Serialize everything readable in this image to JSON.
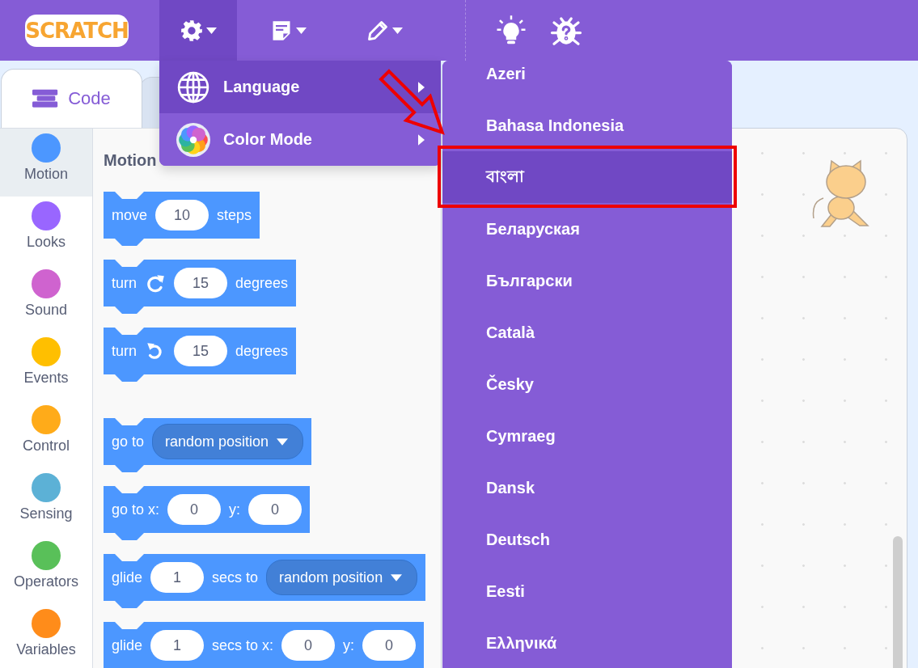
{
  "logo": "SCRATCH",
  "menu_bar": [
    {
      "kind": "settings",
      "selected": true
    },
    {
      "kind": "file",
      "selected": false
    },
    {
      "kind": "edit",
      "selected": false
    }
  ],
  "help_buttons": [
    {
      "kind": "tips"
    },
    {
      "kind": "debug"
    }
  ],
  "settings_menu": [
    {
      "kind": "language",
      "label": "Language",
      "selected": true
    },
    {
      "kind": "color",
      "label": "Color Mode",
      "selected": false
    }
  ],
  "language_menu": [
    {
      "label": "Azeri",
      "selected": false
    },
    {
      "label": "Bahasa Indonesia",
      "selected": false
    },
    {
      "label": "বাংলা",
      "selected": true
    },
    {
      "label": "Беларуская",
      "selected": false
    },
    {
      "label": "Български",
      "selected": false
    },
    {
      "label": "Català",
      "selected": false
    },
    {
      "label": "Česky",
      "selected": false
    },
    {
      "label": "Cymraeg",
      "selected": false
    },
    {
      "label": "Dansk",
      "selected": false
    },
    {
      "label": "Deutsch",
      "selected": false
    },
    {
      "label": "Eesti",
      "selected": false
    },
    {
      "label": "Ελληνικά",
      "selected": false
    }
  ],
  "tabs": [
    {
      "label": "Code",
      "selected": true
    },
    {
      "selected": false
    }
  ],
  "categories": [
    {
      "label": "Motion",
      "color": "#4c97ff",
      "selected": true
    },
    {
      "label": "Looks",
      "color": "#9966ff",
      "selected": false
    },
    {
      "label": "Sound",
      "color": "#cf63cf",
      "selected": false
    },
    {
      "label": "Events",
      "color": "#ffbf00",
      "selected": false
    },
    {
      "label": "Control",
      "color": "#ffab19",
      "selected": false
    },
    {
      "label": "Sensing",
      "color": "#5cb1d6",
      "selected": false
    },
    {
      "label": "Operators",
      "color": "#59c059",
      "selected": false
    },
    {
      "label": "Variables",
      "color": "#ff8c1a",
      "selected": false
    }
  ],
  "palette": {
    "heading": "Motion",
    "block_groups": [
      [
        [
          {
            "kind": "text",
            "text": "move"
          },
          {
            "kind": "number",
            "text": "10"
          },
          {
            "kind": "text",
            "text": "steps"
          }
        ],
        [
          {
            "kind": "text",
            "text": "turn"
          },
          {
            "kind": "clockwise"
          },
          {
            "kind": "number",
            "text": "15"
          },
          {
            "kind": "text",
            "text": "degrees"
          }
        ],
        [
          {
            "kind": "text",
            "text": "turn"
          },
          {
            "kind": "counterclockwise"
          },
          {
            "kind": "number",
            "text": "15"
          },
          {
            "kind": "text",
            "text": "degrees"
          }
        ]
      ],
      [
        [
          {
            "kind": "text",
            "text": "go to"
          },
          {
            "kind": "dropdown",
            "text": "random position"
          }
        ],
        [
          {
            "kind": "text",
            "text": "go to x:"
          },
          {
            "kind": "number",
            "text": "0"
          },
          {
            "kind": "text",
            "text": "y:"
          },
          {
            "kind": "number",
            "text": "0"
          }
        ],
        [
          {
            "kind": "text",
            "text": "glide"
          },
          {
            "kind": "number",
            "text": "1"
          },
          {
            "kind": "text",
            "text": "secs to"
          },
          {
            "kind": "dropdown",
            "text": "random position"
          }
        ],
        [
          {
            "kind": "text",
            "text": "glide"
          },
          {
            "kind": "number",
            "text": "1"
          },
          {
            "kind": "text",
            "text": "secs to x:"
          },
          {
            "kind": "number",
            "text": "0"
          },
          {
            "kind": "text",
            "text": "y:"
          },
          {
            "kind": "number",
            "text": "0"
          }
        ]
      ]
    ]
  }
}
